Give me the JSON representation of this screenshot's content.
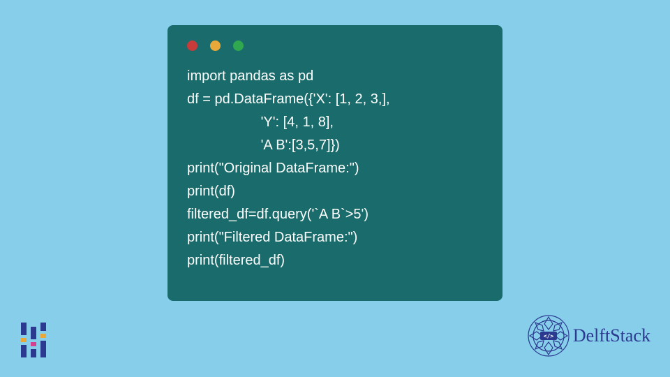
{
  "code": {
    "line1": "import pandas as pd",
    "line2": "df = pd.DataFrame({'X': [1, 2, 3,],",
    "line3": "                   'Y': [4, 1, 8],",
    "line4": "                   'A B':[3,5,7]})",
    "line5": "print(\"Original DataFrame:\")",
    "line6": "print(df)",
    "line7": "filtered_df=df.query('`A B`>5')",
    "line8": "print(\"Filtered DataFrame:\")",
    "line9": "print(filtered_df)"
  },
  "brand": {
    "name": "DelftStack"
  },
  "colors": {
    "background": "#87ceeb",
    "codeWindow": "#1a6c6c",
    "brandBlue": "#2b3a8f"
  }
}
